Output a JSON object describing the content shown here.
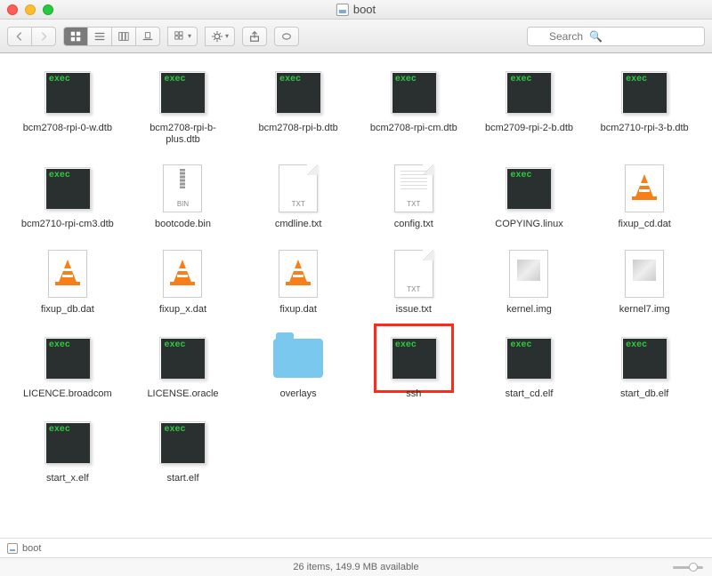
{
  "window": {
    "title": "boot"
  },
  "toolbar": {
    "search_placeholder": "Search"
  },
  "pathbar": {
    "volume": "boot"
  },
  "statusbar": {
    "text": "26 items, 149.9 MB available"
  },
  "files": [
    {
      "name": "bcm2708-rpi-0-w.dtb",
      "type": "exec",
      "highlighted": false
    },
    {
      "name": "bcm2708-rpi-b-plus.dtb",
      "type": "exec",
      "highlighted": false
    },
    {
      "name": "bcm2708-rpi-b.dtb",
      "type": "exec",
      "highlighted": false
    },
    {
      "name": "bcm2708-rpi-cm.dtb",
      "type": "exec",
      "highlighted": false
    },
    {
      "name": "bcm2709-rpi-2-b.dtb",
      "type": "exec",
      "highlighted": false
    },
    {
      "name": "bcm2710-rpi-3-b.dtb",
      "type": "exec",
      "highlighted": false
    },
    {
      "name": "bcm2710-rpi-cm3.dtb",
      "type": "exec",
      "highlighted": false
    },
    {
      "name": "bootcode.bin",
      "type": "bin",
      "highlighted": false
    },
    {
      "name": "cmdline.txt",
      "type": "txt",
      "highlighted": false
    },
    {
      "name": "config.txt",
      "type": "txt-lines",
      "highlighted": false
    },
    {
      "name": "COPYING.linux",
      "type": "exec",
      "highlighted": false
    },
    {
      "name": "fixup_cd.dat",
      "type": "vlc",
      "highlighted": false
    },
    {
      "name": "fixup_db.dat",
      "type": "vlc",
      "highlighted": false
    },
    {
      "name": "fixup_x.dat",
      "type": "vlc",
      "highlighted": false
    },
    {
      "name": "fixup.dat",
      "type": "vlc",
      "highlighted": false
    },
    {
      "name": "issue.txt",
      "type": "txt",
      "highlighted": false
    },
    {
      "name": "kernel.img",
      "type": "img",
      "highlighted": false
    },
    {
      "name": "kernel7.img",
      "type": "img",
      "highlighted": false
    },
    {
      "name": "LICENCE.broadcom",
      "type": "exec",
      "highlighted": false
    },
    {
      "name": "LICENSE.oracle",
      "type": "exec",
      "highlighted": false
    },
    {
      "name": "overlays",
      "type": "folder",
      "highlighted": false
    },
    {
      "name": "ssh",
      "type": "exec",
      "highlighted": true
    },
    {
      "name": "start_cd.elf",
      "type": "exec",
      "highlighted": false
    },
    {
      "name": "start_db.elf",
      "type": "exec",
      "highlighted": false
    },
    {
      "name": "start_x.elf",
      "type": "exec",
      "highlighted": false
    },
    {
      "name": "start.elf",
      "type": "exec",
      "highlighted": false
    }
  ]
}
